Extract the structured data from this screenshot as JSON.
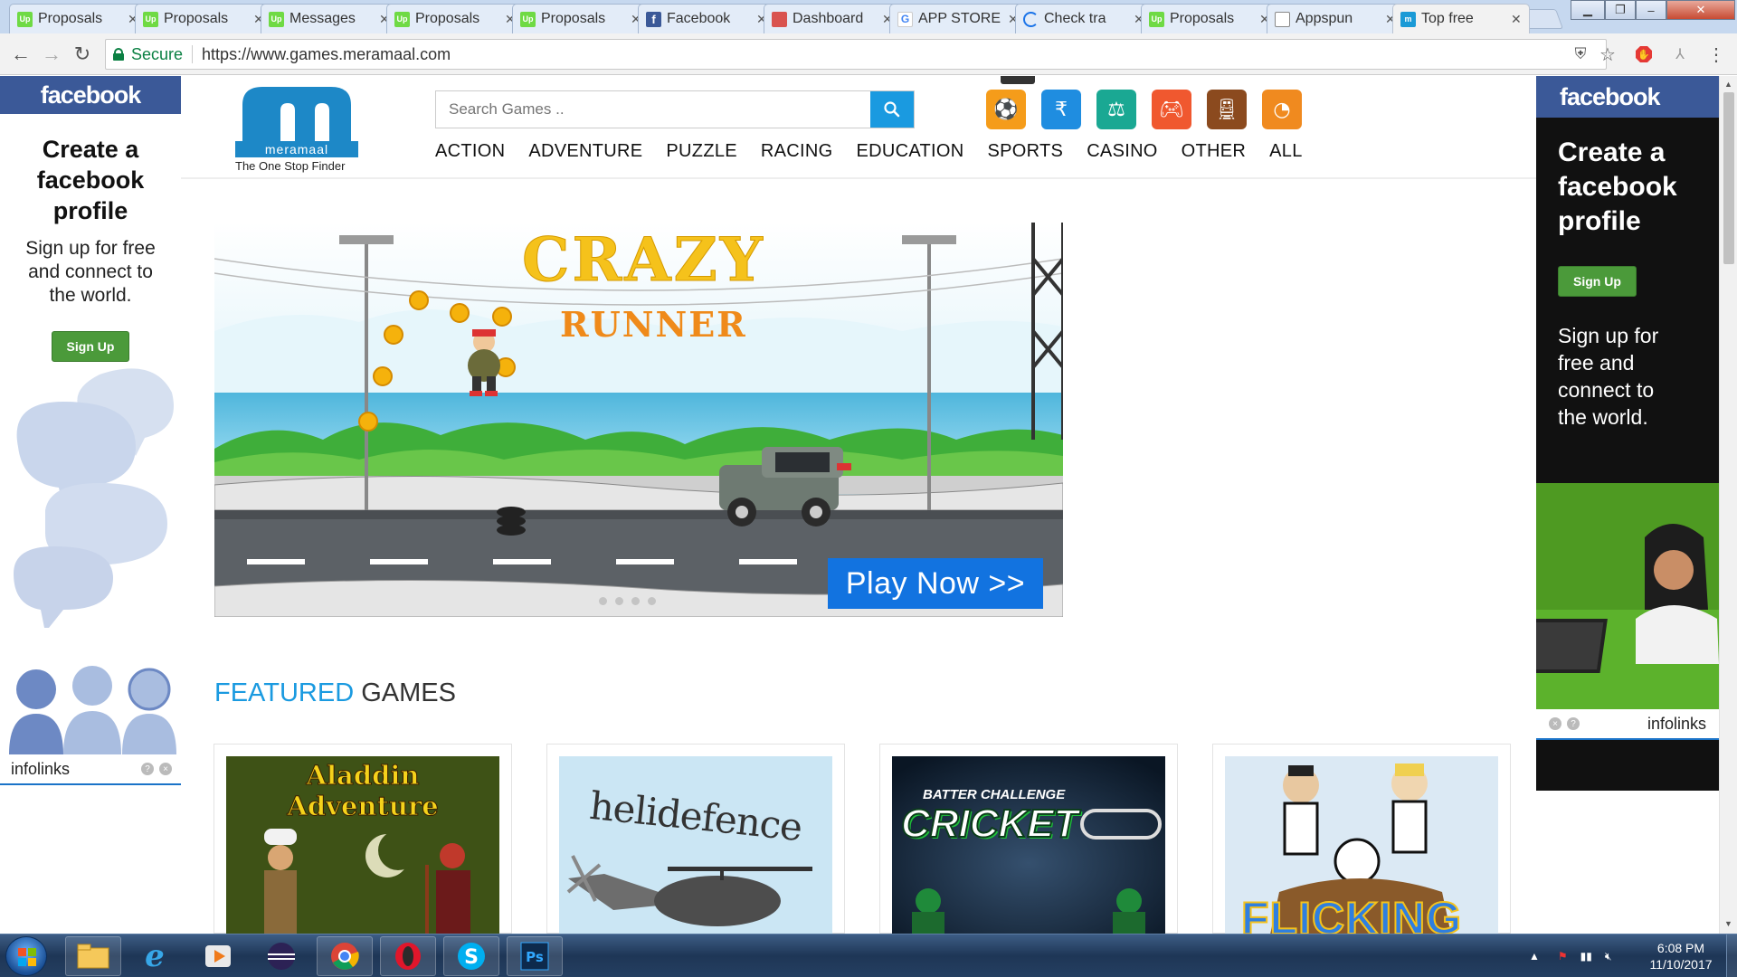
{
  "browser": {
    "tabs": [
      {
        "label": "Proposals",
        "icon": "upwork-icon",
        "favtext": "Up"
      },
      {
        "label": "Proposals",
        "icon": "upwork-icon",
        "favtext": "Up"
      },
      {
        "label": "Messages",
        "icon": "upwork-icon",
        "favtext": "Up"
      },
      {
        "label": "Proposals",
        "icon": "upwork-icon",
        "favtext": "Up"
      },
      {
        "label": "Proposals",
        "icon": "upwork-icon",
        "favtext": "Up"
      },
      {
        "label": "Facebook",
        "icon": "facebook-icon",
        "favtext": "f"
      },
      {
        "label": "Dashboard",
        "icon": "dashboard-icon",
        "favtext": ""
      },
      {
        "label": "APP STORE",
        "icon": "google-icon",
        "favtext": "G"
      },
      {
        "label": "Check tra",
        "icon": "loading-icon",
        "favtext": ""
      },
      {
        "label": "Proposals",
        "icon": "upwork-icon",
        "favtext": "Up"
      },
      {
        "label": "Appspun",
        "icon": "document-icon",
        "favtext": ""
      },
      {
        "label": "Top free",
        "icon": "meramaal-icon",
        "favtext": "m"
      }
    ],
    "secure_label": "Secure",
    "url": "https://www.games.meramaal.com"
  },
  "site": {
    "logo_word": "meramaal",
    "logo_tagline": "The One Stop Finder",
    "search_placeholder": "Search Games ..",
    "category_icons": [
      {
        "name": "sports-category-icon",
        "color": "#f59c1a"
      },
      {
        "name": "casino-rupee-category-icon",
        "color": "#1f8de0"
      },
      {
        "name": "seesaw-category-icon",
        "color": "#1aa893"
      },
      {
        "name": "gamepad-category-icon",
        "color": "#f0582f"
      },
      {
        "name": "train-category-icon",
        "color": "#8b4a1e"
      },
      {
        "name": "rss-category-icon",
        "color": "#f08a1f"
      }
    ],
    "menu": [
      "ACTION",
      "ADVENTURE",
      "PUZZLE",
      "RACING",
      "EDUCATION",
      "SPORTS",
      "CASINO",
      "OTHER",
      "ALL"
    ],
    "banner": {
      "title_line1": "CRAZY",
      "title_line2": "RUNNER",
      "play_label": "Play Now >>"
    },
    "featured_highlight": "FEATURED",
    "featured_rest": "GAMES",
    "games": [
      {
        "title": "Aladdin Adventure"
      },
      {
        "title": "helidefence"
      },
      {
        "title": "BATTER CHALLENGE",
        "title2": "CRICKET"
      },
      {
        "title": "FLICKING"
      }
    ]
  },
  "ads": {
    "left": {
      "brand": "facebook",
      "title": "Create a facebook profile",
      "subtitle": "Sign up for free and connect to the world.",
      "button": "Sign Up",
      "network": "infolinks"
    },
    "right": {
      "brand": "facebook",
      "title": "Create a facebook profile",
      "button": "Sign Up",
      "subtitle": "Sign up for free and connect to the world.",
      "network": "infolinks"
    }
  },
  "taskbar": {
    "time": "6:08 PM",
    "date": "11/10/2017"
  }
}
